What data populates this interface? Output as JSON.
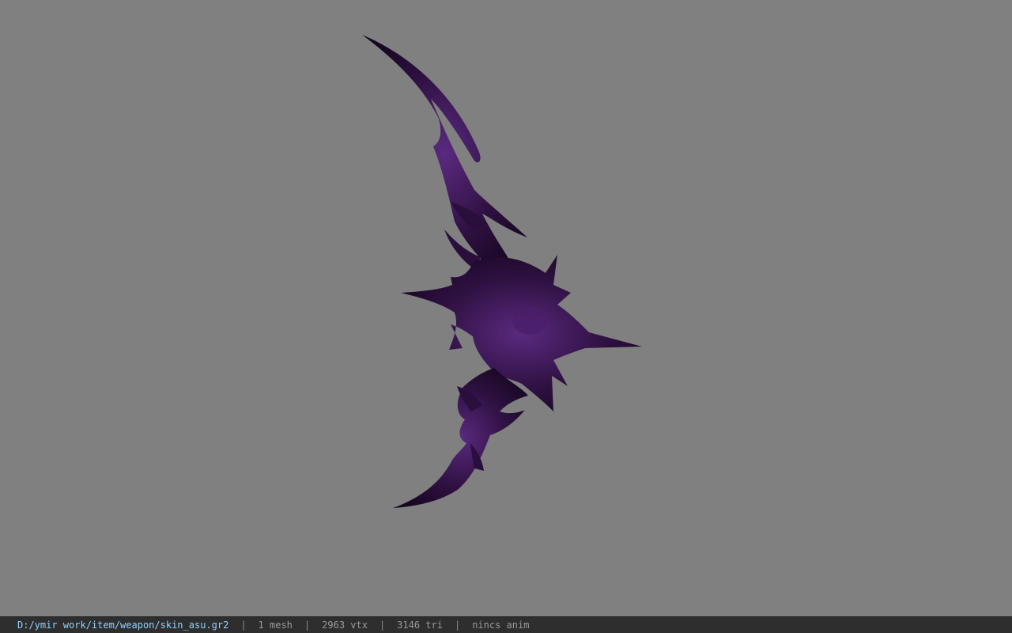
{
  "viewer": {
    "background_color": "#808080",
    "model_color": "#3a1550",
    "model_icon": "purple-spiked-bow-model"
  },
  "status": {
    "file_path": "D:/ymir work/item/weapon/skin_asu.gr2",
    "mesh_count": "1 mesh",
    "vertex_count": "2963 vtx",
    "triangle_count": "3146 tri",
    "anim": "nincs anim",
    "separator": "|"
  }
}
